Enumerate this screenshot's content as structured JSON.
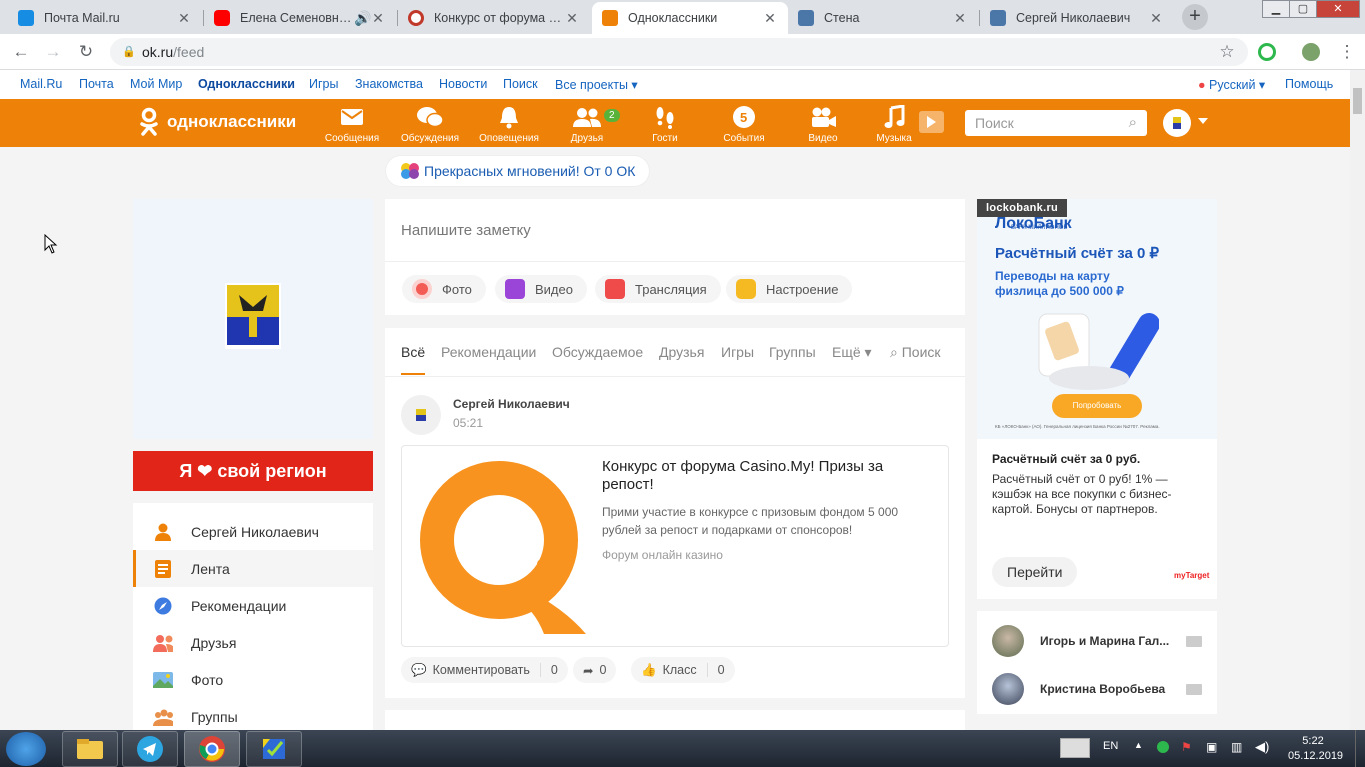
{
  "browser": {
    "tabs": [
      {
        "title": "Почта Mail.ru",
        "icon": "mail-icon",
        "color": "#168de2"
      },
      {
        "title": "Елена Семеновна и",
        "icon": "youtube-icon",
        "color": "#ff0000"
      },
      {
        "title": "Конкурс от форума Cas",
        "icon": "casino-icon",
        "color": "#c0392b"
      },
      {
        "title": "Одноклассники",
        "icon": "ok-icon",
        "color": "#ee8208"
      },
      {
        "title": "Стена",
        "icon": "vk-icon",
        "color": "#4a76a8"
      },
      {
        "title": "Сергей Николаевич",
        "icon": "vk-icon",
        "color": "#4a76a8"
      }
    ],
    "url_host": "ok.ru",
    "url_path": "/feed"
  },
  "portal": {
    "links": [
      "Mail.Ru",
      "Почта",
      "Мой Мир",
      "Одноклассники",
      "Игры",
      "Знакомства",
      "Новости",
      "Поиск",
      "Все проекты ▾"
    ],
    "language": "Русский ▾",
    "help": "Помощь"
  },
  "header": {
    "logo_text": "одноклассники",
    "nav": [
      {
        "label": "Сообщения",
        "icon": "envelope-icon"
      },
      {
        "label": "Обсуждения",
        "icon": "chat-bubbles-icon"
      },
      {
        "label": "Оповещения",
        "icon": "bell-icon"
      },
      {
        "label": "Друзья",
        "icon": "friends-icon",
        "badge": "2"
      },
      {
        "label": "Гости",
        "icon": "footprints-icon"
      },
      {
        "label": "События",
        "icon": "events-icon",
        "badge": "5"
      },
      {
        "label": "Видео",
        "icon": "video-camera-icon"
      },
      {
        "label": "Музыка",
        "icon": "music-note-icon"
      }
    ],
    "search_placeholder": "Поиск"
  },
  "greeting": "Прекрасных мгновений! От 0 ОК",
  "left": {
    "region_banner": "Я ❤ свой регион",
    "menu": [
      {
        "label": "Сергей Николаевич",
        "icon": "user-icon"
      },
      {
        "label": "Лента",
        "icon": "feed-icon"
      },
      {
        "label": "Рекомендации",
        "icon": "compass-icon"
      },
      {
        "label": "Друзья",
        "icon": "friends-icon"
      },
      {
        "label": "Фото",
        "icon": "photo-icon"
      },
      {
        "label": "Группы",
        "icon": "groups-icon"
      }
    ]
  },
  "composer": {
    "placeholder": "Напишите заметку",
    "actions": [
      "Фото",
      "Видео",
      "Трансляция",
      "Настроение"
    ]
  },
  "feed": {
    "tabs": [
      "Всё",
      "Рекомендации",
      "Обсуждаемое",
      "Друзья",
      "Игры",
      "Группы",
      "Ещё ▾",
      "Поиск"
    ],
    "post": {
      "author": "Сергей Николаевич",
      "time": "05:21",
      "title": "Конкурс от форума Casino.My! Призы за репост!",
      "description": "Прими участие в конкурсе с призовым фондом 5 000 рублей за репост и подарками от спонсоров!",
      "source": "Форум онлайн казино",
      "comment_label": "Комментировать",
      "comment_count": "0",
      "share_count": "0",
      "like_label": "Класс",
      "like_count": "0"
    }
  },
  "ad": {
    "source": "lockobank.ru",
    "brand": "ЛокоБанк",
    "brand_sub": "БАНК МИЛЛИОНОВ",
    "headline": "Расчётный счёт за 0 ₽",
    "subline": "Переводы на карту физлица до 500 000 ₽",
    "try_button": "Попробовать",
    "license": "КБ «ЛОКО-Банк» (АО). Генеральная лицензия Банка России №2707. Реклама.",
    "title": "Расчётный счёт за 0 руб.",
    "text": "Расчётный счёт от 0 руб! 1% — кэшбэк на все покупки с бизнес-картой. Бонусы от партнеров.",
    "button": "Перейти",
    "network_logo": "myTarget"
  },
  "friends_online": [
    {
      "name": "Игорь и Марина Гал..."
    },
    {
      "name": "Кристина Воробьева"
    }
  ],
  "taskbar": {
    "lang": "EN",
    "time": "5:22",
    "date": "05.12.2019"
  }
}
